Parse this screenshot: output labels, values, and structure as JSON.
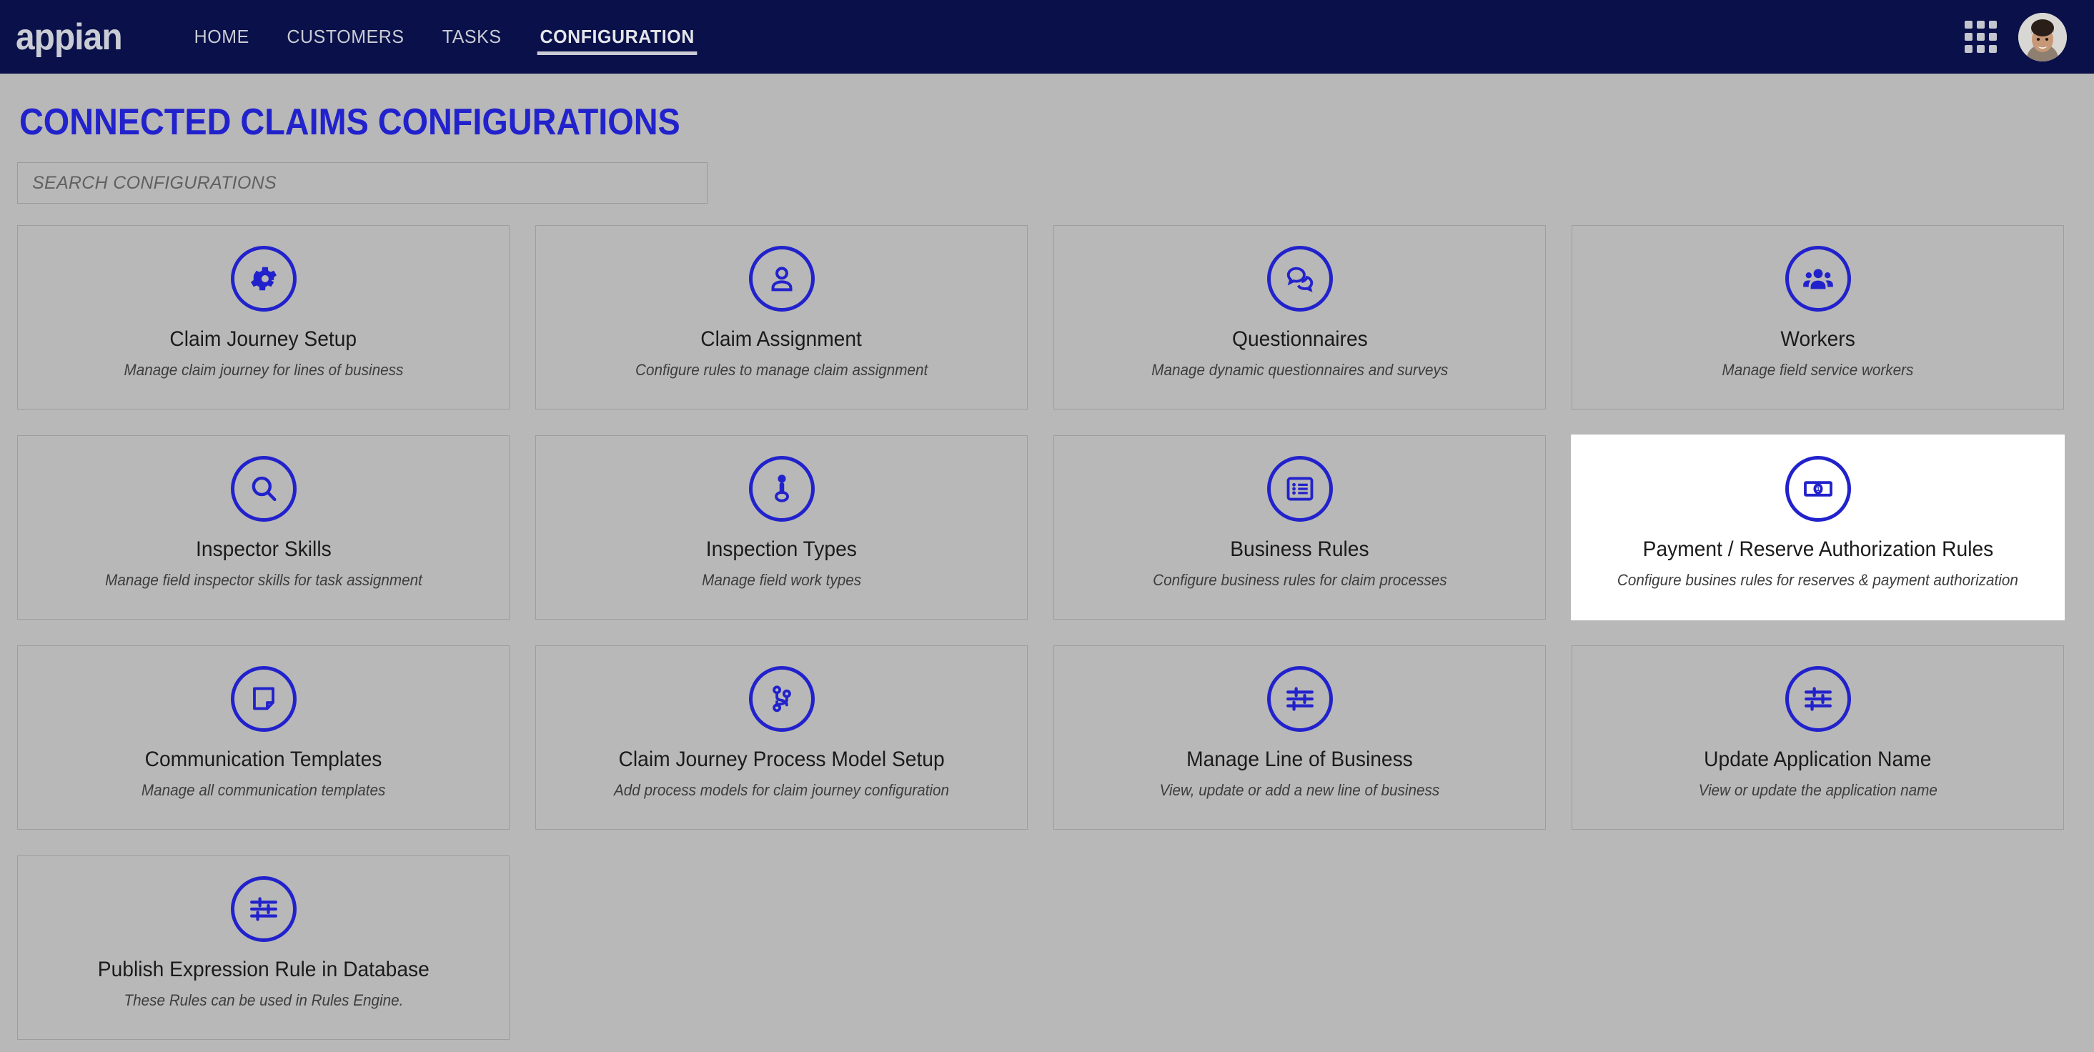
{
  "header": {
    "brand": "appian",
    "nav": [
      {
        "label": "HOME",
        "active": false
      },
      {
        "label": "CUSTOMERS",
        "active": false
      },
      {
        "label": "TASKS",
        "active": false
      },
      {
        "label": "CONFIGURATION",
        "active": true
      }
    ],
    "apps_icon": "apps-grid-icon",
    "avatar_icon": "user-avatar-photo"
  },
  "page": {
    "title": "CONNECTED CLAIMS CONFIGURATIONS",
    "title_color": "#2222cc",
    "background_color": "#b8b8b8",
    "header_color": "#0a1049"
  },
  "search": {
    "placeholder": "SEARCH CONFIGURATIONS",
    "value": ""
  },
  "cards": [
    {
      "title": "Claim Journey Setup",
      "desc": "Manage claim journey for lines of business",
      "icon": "gear-icon",
      "highlighted": false
    },
    {
      "title": "Claim Assignment",
      "desc": "Configure rules to manage claim assignment",
      "icon": "user-icon",
      "highlighted": false
    },
    {
      "title": "Questionnaires",
      "desc": "Manage dynamic questionnaires and surveys",
      "icon": "chat-bubbles-icon",
      "highlighted": false
    },
    {
      "title": "Workers",
      "desc": "Manage field service workers",
      "icon": "people-group-icon",
      "highlighted": false
    },
    {
      "title": "Inspector Skills",
      "desc": "Manage field inspector skills for task assignment",
      "icon": "magnifier-icon",
      "highlighted": false
    },
    {
      "title": "Inspection Types",
      "desc": "Manage field work types",
      "icon": "person-standing-icon",
      "highlighted": false
    },
    {
      "title": "Business Rules",
      "desc": "Configure business rules for claim processes",
      "icon": "list-box-icon",
      "highlighted": false
    },
    {
      "title": "Payment / Reserve Authorization Rules",
      "desc": "Configure busines rules for reserves & payment authorization",
      "icon": "banknote-icon",
      "highlighted": true
    },
    {
      "title": "Communication Templates",
      "desc": "Manage all communication templates",
      "icon": "note-edit-icon",
      "highlighted": false
    },
    {
      "title": "Claim Journey Process Model Setup",
      "desc": "Add process models for claim journey configuration",
      "icon": "branch-flow-icon",
      "highlighted": false
    },
    {
      "title": "Manage Line of Business",
      "desc": "View, update or add a new line of business",
      "icon": "sliders-icon",
      "highlighted": false
    },
    {
      "title": "Update Application Name",
      "desc": "View or update the application name",
      "icon": "sliders-icon",
      "highlighted": false
    },
    {
      "title": "Publish Expression Rule in Database",
      "desc": "These Rules can be used in Rules Engine.",
      "icon": "sliders-icon",
      "highlighted": false
    }
  ],
  "colors": {
    "accent_blue": "#2222cc",
    "nav_text": "#c9ccd4",
    "card_border": "#9d9d9d"
  }
}
